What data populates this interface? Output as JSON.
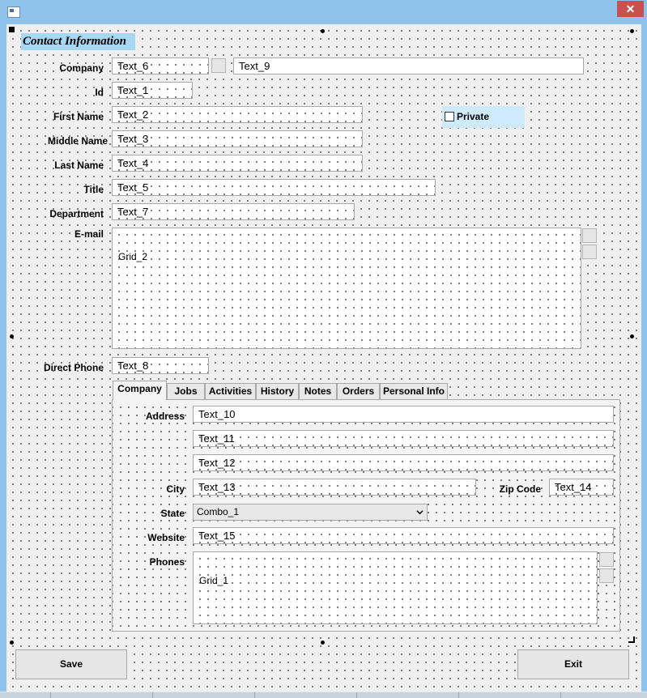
{
  "window": {
    "close_glyph": "✕"
  },
  "form": {
    "heading": "Contact Information",
    "private_label": "Private",
    "fields": {
      "company": {
        "label": "Company",
        "value": "Text_6",
        "value2": "Text_9"
      },
      "id": {
        "label": "Id",
        "value": "Text_1"
      },
      "first_name": {
        "label": "First Name",
        "value": "Text_2"
      },
      "middle_name": {
        "label": "Middle Name",
        "value": "Text_3"
      },
      "last_name": {
        "label": "Last Name",
        "value": "Text_4"
      },
      "title": {
        "label": "Title",
        "value": "Text_5"
      },
      "department": {
        "label": "Department",
        "value": "Text_7"
      },
      "email": {
        "label": "E-mail",
        "grid": "Grid_2"
      },
      "direct_phone": {
        "label": "Direct Phone",
        "value": "Text_8"
      }
    },
    "tabs": [
      "Company",
      "Jobs",
      "Activities",
      "History",
      "Notes",
      "Orders",
      "Personal Info"
    ],
    "company_tab": {
      "address_label": "Address",
      "address1": "Text_10",
      "address2": "Text_11",
      "address3": "Text_12",
      "city_label": "City",
      "city": "Text_13",
      "zip_label": "Zip Code",
      "zip": "Text_14",
      "state_label": "State",
      "state": "Combo_1",
      "website_label": "Website",
      "website": "Text_15",
      "phones_label": "Phones",
      "phones_grid": "Grid_1"
    },
    "buttons": {
      "save": "Save",
      "exit": "Exit"
    }
  },
  "icons": [
    "app-icon",
    "close-icon",
    "checkbox-icon",
    "dropdown-arrow-icon",
    "resize-grip-icon"
  ]
}
